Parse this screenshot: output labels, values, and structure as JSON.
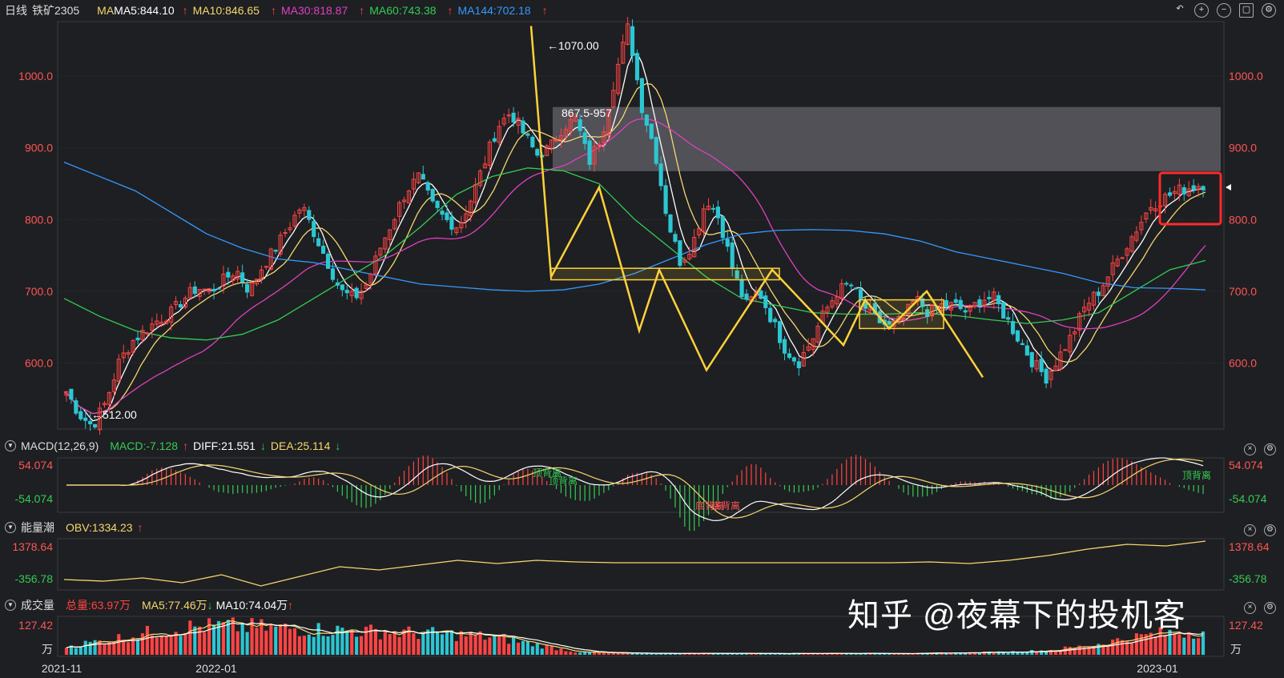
{
  "header": {
    "period": "日线",
    "symbol": "铁矿2305",
    "ma_label": "MA",
    "ma5": "MA5:844.10",
    "ma10": "MA10:846.65",
    "ma30": "MA30:818.87",
    "ma60": "MA60:743.38",
    "ma144": "MA144:702.18",
    "arrow_up": "↑"
  },
  "toolbar": {
    "icons": [
      "undo-icon",
      "zoom-in-icon",
      "zoom-out-icon",
      "window-icon",
      "settings-icon"
    ]
  },
  "price_axis": {
    "ticks": [
      "1000.0",
      "900.0",
      "800.0",
      "700.0",
      "600.0"
    ]
  },
  "annotations": {
    "high": "←1070.00",
    "low": "←512.00",
    "gap": "867.5-957"
  },
  "macd": {
    "title": "MACD(12,26,9)",
    "macd": "MACD:-7.128",
    "diff": "DIFF:21.551",
    "dea": "DEA:25.114",
    "top": "54.074",
    "bottom": "-54.074",
    "labels": [
      "顶背离",
      "顶背离",
      "底背离",
      "底背离",
      "顶背离"
    ]
  },
  "obv": {
    "title": "能量潮",
    "obv": "OBV:1334.23",
    "top": "1378.64",
    "bottom": "-356.78"
  },
  "volume": {
    "title": "成交量",
    "total": "总量:63.97万",
    "ma5": "MA5:77.46万",
    "ma10": "MA10:74.04万",
    "top": "127.42",
    "unit": "万"
  },
  "x_axis": {
    "labels": [
      "2021-11",
      "2022-01",
      "2023-01"
    ]
  },
  "watermark": "知乎 @夜幕下的投机客",
  "colors": {
    "up": "#ff4444",
    "down": "#2cc6d3",
    "ma5": "#ffffff",
    "ma10": "#f5d76e",
    "ma30": "#e040c0",
    "ma60": "#33cc55",
    "ma144": "#3399ff",
    "pattern": "#ffd23a",
    "zone": "#5a5b60"
  },
  "chart_data": [
    {
      "type": "candlestick",
      "title": "铁矿2305 日线",
      "ylim": [
        510,
        1075
      ],
      "x": [
        "2021-11",
        "2022-01",
        "2023-01"
      ],
      "close_path": [
        560,
        528,
        512,
        545,
        600,
        630,
        645,
        660,
        670,
        690,
        705,
        700,
        715,
        730,
        700,
        735,
        760,
        790,
        820,
        780,
        740,
        700,
        690,
        710,
        760,
        800,
        840,
        860,
        820,
        800,
        790,
        830,
        880,
        930,
        950,
        920,
        890,
        900,
        930,
        940,
        880,
        920,
        1000,
        1070,
        960,
        900,
        800,
        740,
        770,
        830,
        800,
        730,
        680,
        700,
        660,
        620,
        600,
        630,
        670,
        700,
        710,
        680,
        660,
        650,
        660,
        690,
        670,
        680,
        680,
        670,
        690,
        690,
        660,
        630,
        600,
        580,
        610,
        640,
        680,
        700,
        730,
        760,
        790,
        820,
        830,
        840,
        845,
        850
      ],
      "ma144": [
        880,
        860,
        840,
        810,
        780,
        760,
        745,
        740,
        730,
        720,
        710,
        706,
        702,
        700,
        702,
        710,
        725,
        745,
        765,
        780,
        785,
        786,
        785,
        780,
        770,
        755,
        745,
        735,
        725,
        712,
        705,
        704,
        702
      ],
      "ma60": [
        690,
        665,
        645,
        635,
        632,
        640,
        660,
        690,
        720,
        750,
        790,
        835,
        860,
        872,
        868,
        850,
        800,
        760,
        720,
        690,
        680,
        670,
        668,
        668,
        670,
        666,
        660,
        655,
        660,
        670,
        700,
        730,
        743
      ],
      "zone": [
        867.5,
        957
      ],
      "high": 1070,
      "low": 512
    },
    {
      "type": "line",
      "title": "MACD(12,26,9)",
      "ylim": [
        -54.074,
        54.074
      ],
      "diff": 21.551,
      "dea": 25.114,
      "macd": -7.128
    },
    {
      "type": "line",
      "title": "能量潮",
      "ylim": [
        -356.78,
        1378.64
      ],
      "obv": 1334.23
    },
    {
      "type": "bar",
      "title": "成交量",
      "ylim": [
        0,
        127.42
      ],
      "unit": "万",
      "total": 63.97,
      "ma5": 77.46,
      "ma10": 74.04
    }
  ]
}
